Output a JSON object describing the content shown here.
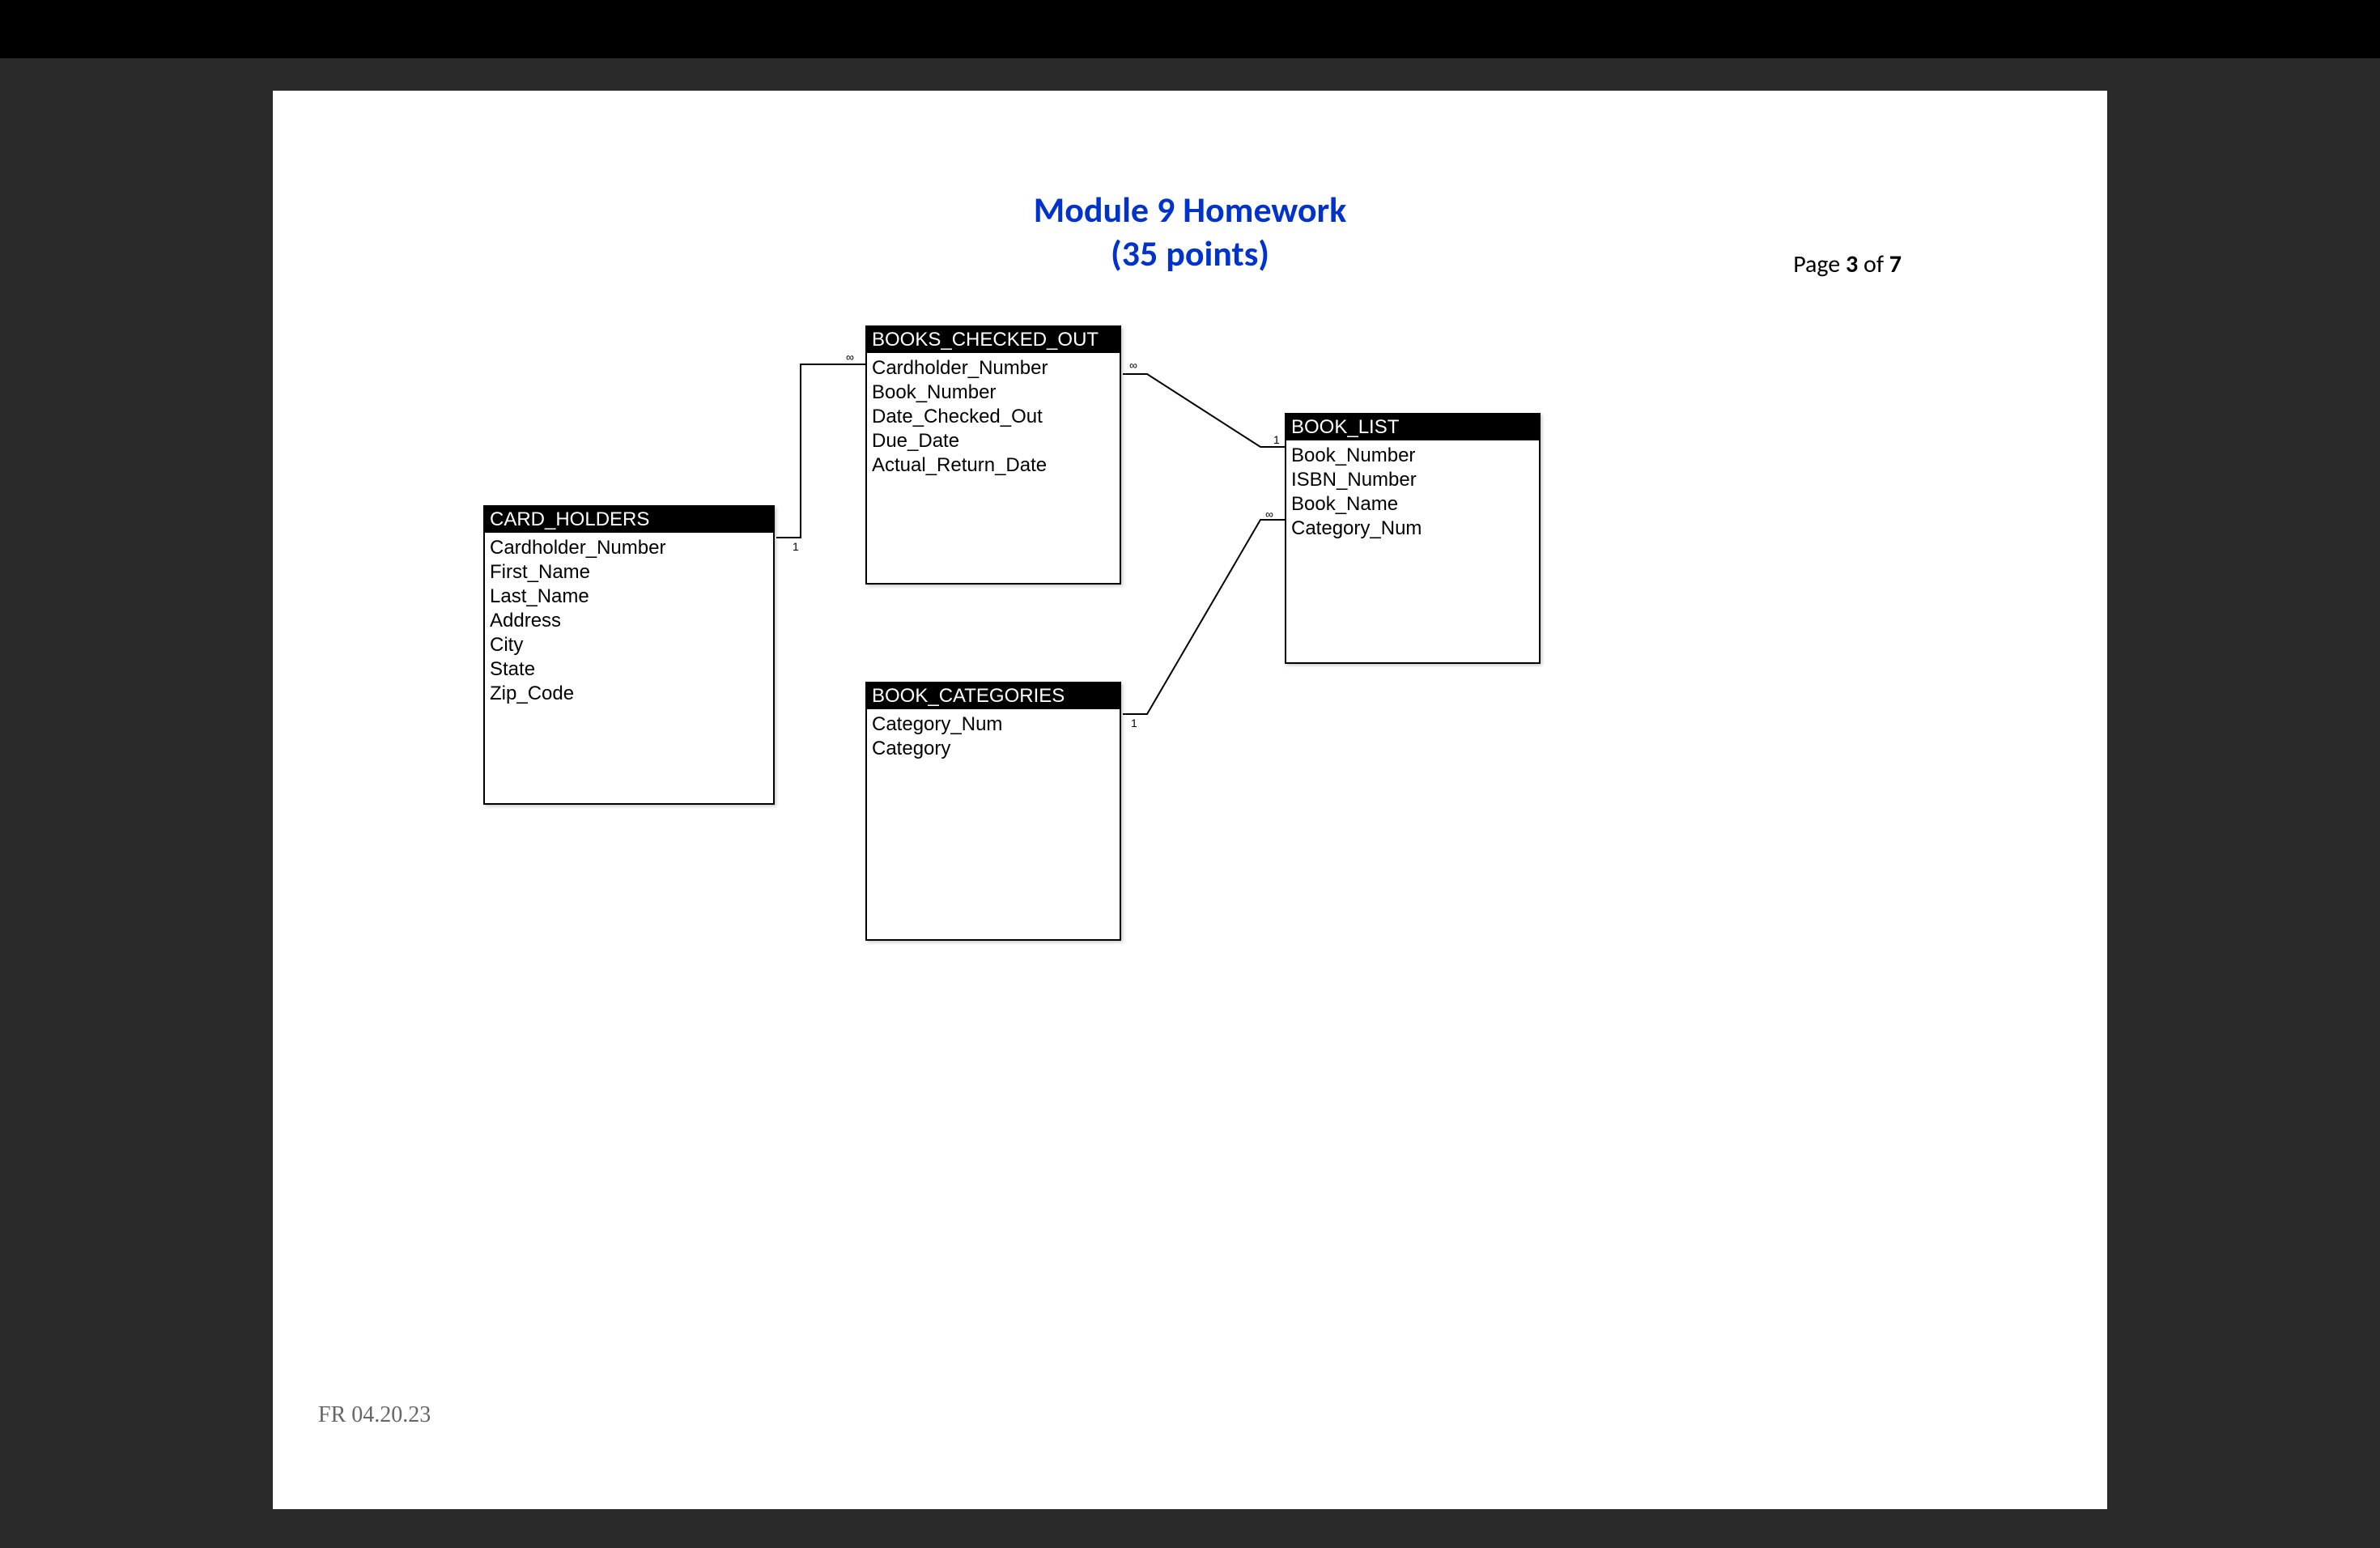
{
  "header": {
    "title_line1": "Module 9 Homework",
    "title_line2": "(35 points)"
  },
  "page_info": {
    "prefix": "Page ",
    "current": "3",
    "sep": " of ",
    "total": "7"
  },
  "footer": {
    "text": "FR 04.20.23"
  },
  "entities": {
    "card_holders": {
      "name": "CARD_HOLDERS",
      "fields": [
        "Cardholder_Number",
        "First_Name",
        "Last_Name",
        "Address",
        "City",
        "State",
        "Zip_Code"
      ]
    },
    "books_checked_out": {
      "name": "BOOKS_CHECKED_OUT",
      "fields": [
        "Cardholder_Number",
        "Book_Number",
        "Date_Checked_Out",
        "Due_Date",
        "Actual_Return_Date"
      ]
    },
    "book_categories": {
      "name": "BOOK_CATEGORIES",
      "fields": [
        "Category_Num",
        "Category"
      ]
    },
    "book_list": {
      "name": "BOOK_LIST",
      "fields": [
        "Book_Number",
        "ISBN_Number",
        "Book_Name",
        "Category_Num"
      ]
    }
  },
  "relationships": [
    {
      "from": "CARD_HOLDERS",
      "to": "BOOKS_CHECKED_OUT",
      "from_card": "1",
      "to_card": "∞"
    },
    {
      "from": "BOOKS_CHECKED_OUT",
      "to": "BOOK_LIST",
      "from_card": "∞",
      "to_card": "1"
    },
    {
      "from": "BOOK_CATEGORIES",
      "to": "BOOK_LIST",
      "from_card": "1",
      "to_card": "∞"
    }
  ],
  "cardinality": {
    "one": "1",
    "many": "∞"
  }
}
